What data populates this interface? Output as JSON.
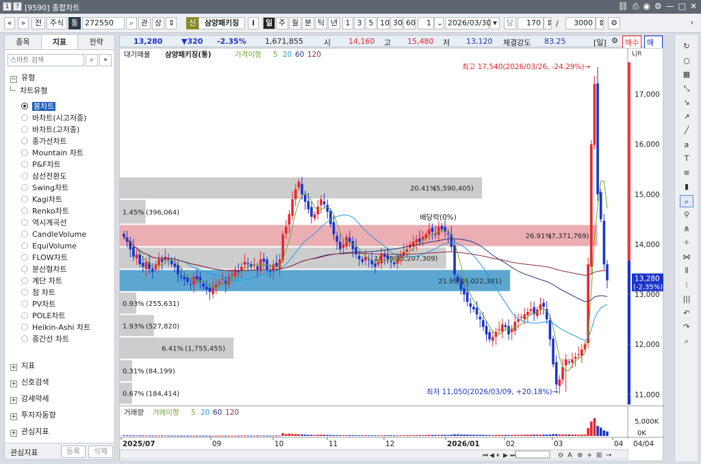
{
  "window": {
    "title": "[9590] 종합차트"
  },
  "toolbar": {
    "market_label": "전",
    "stock_label": "주식",
    "type_badge": "통",
    "code": "272550",
    "gwan": "관",
    "sang": "상",
    "sin_badge": "신",
    "name": "삼양패키징",
    "info_label": "i",
    "periods": [
      "일",
      "주",
      "월",
      "분",
      "틱",
      "년"
    ],
    "minutes": [
      "1",
      "3",
      "5",
      "10",
      "30",
      "60"
    ],
    "interval": "1",
    "date": "2026/03/30",
    "dang": "당",
    "count": "170",
    "slash": "/",
    "total": "3000"
  },
  "left": {
    "tabs": [
      "종목",
      "지표",
      "전략"
    ],
    "search_placeholder": "스마트 검색",
    "group_title": "유형",
    "subgroup": "차트유형",
    "chart_types": [
      "봉차트",
      "바차트(시고저종)",
      "바차트(고저종)",
      "종가선차트",
      "Mountain 차트",
      "P&F차트",
      "삼선전환도",
      "Swing차트",
      "Kagi차트",
      "Renko차트",
      "역시계곡선",
      "CandleVolume",
      "EquiVolume",
      "FLOW차트",
      "분산형차트",
      "계단 차트",
      "점 차트",
      "PV차트",
      "POLE차트",
      "Heikin-Ashi 차트",
      "중간선 차트"
    ],
    "sections": [
      "지표",
      "신호검색",
      "강세약세",
      "투자자동향",
      "관심지표"
    ],
    "bottom_label": "관심지표",
    "register": "등록",
    "delete": "삭제"
  },
  "quote": {
    "price": "13,280",
    "change": "▼320",
    "pct": "-2.35%",
    "volume": "1,671,855",
    "open_label": "시",
    "open": "14,160",
    "high_label": "고",
    "high": "15,480",
    "low_label": "저",
    "low": "13,120",
    "strength_label": "체결강도",
    "strength": "83.25",
    "period_tag": "[일]",
    "buy": "매수",
    "sell": "매도"
  },
  "legend": {
    "title": "대기매물",
    "stock": "삼양패키징(통)",
    "ma_label": "가격이평",
    "ma": [
      "5",
      "20",
      "60",
      "120"
    ]
  },
  "vol_legend": {
    "title": "거래량",
    "ma_label": "거래이평",
    "ma": [
      "5",
      "20",
      "60",
      "120"
    ]
  },
  "annotations": {
    "high": "최고 17,540(2026/03/26, -24.29%)→",
    "low": "최저 11,050(2026/03/09, +20.18%)→",
    "dividend": "배당락(0%)",
    "current_price": "13,280",
    "current_pct": "(-2.35%)"
  },
  "x_labels": [
    "2025/07",
    "09",
    "10",
    "11",
    "12",
    "2026/01",
    "02",
    "03",
    "04"
  ],
  "x_right": "04/04",
  "y_labels": [
    "17,000",
    "16,000",
    "15,000",
    "14,000",
    "13,000",
    "12,000",
    "11,000"
  ],
  "vol_labels": [
    "5,000K",
    "0K"
  ],
  "colors": {
    "up": "#e8262c",
    "down": "#1b35c8",
    "ma5": "#6aa82b",
    "ma20": "#1e9be0",
    "ma60": "#26307c",
    "ma120": "#8a2b3a",
    "band_pink": "#e8a0a6",
    "band_blue": "#3f98c9",
    "band_gray": "#c8c8c8"
  },
  "chart_data": {
    "type": "candlestick",
    "title": "삼양패키징(통)",
    "ylim": [
      10800,
      17800
    ],
    "volume_profile": [
      {
        "price_low": 14900,
        "price_high": 15350,
        "pct": "20.41%",
        "vol": "(5,590,405)"
      },
      {
        "price_low": 14400,
        "price_high": 14900,
        "pct": "1.45%",
        "vol": "(396,064)"
      },
      {
        "price_low": 13950,
        "price_high": 14400,
        "pct": "26.91%",
        "vol": "(7,371,769)",
        "highlight": "pink"
      },
      {
        "price_low": 13500,
        "price_high": 13950,
        "pct": "18.39%",
        "vol": "(5,207,309)"
      },
      {
        "price_low": 13050,
        "price_high": 13500,
        "pct": "21.99%",
        "vol": "(6,022,381)",
        "highlight": "blue"
      },
      {
        "price_low": 12600,
        "price_high": 13050,
        "pct": "0.93%",
        "vol": "(255,631)"
      },
      {
        "price_low": 12150,
        "price_high": 12600,
        "pct": "1.93%",
        "vol": "(527,820)"
      },
      {
        "price_low": 11700,
        "price_high": 12150,
        "pct": "6.41%",
        "vol": "(1,755,455)"
      },
      {
        "price_low": 11250,
        "price_high": 11700,
        "pct": "0.31%",
        "vol": "(84,199)"
      },
      {
        "price_low": 10800,
        "price_high": 11250,
        "pct": "0.67%",
        "vol": "(184,414)"
      }
    ],
    "closes": [
      14150,
      14050,
      13900,
      13750,
      13800,
      13600,
      13550,
      13650,
      13500,
      13450,
      13600,
      13700,
      13650,
      13750,
      13700,
      13600,
      13550,
      13400,
      13350,
      13300,
      13250,
      13200,
      13350,
      13300,
      13250,
      13150,
      13100,
      13050,
      13150,
      13200,
      13250,
      13300,
      13200,
      13350,
      13400,
      13500,
      13450,
      13550,
      13650,
      13600,
      13550,
      13600,
      13500,
      13700,
      13650,
      13500,
      13450,
      13600,
      13550,
      13700,
      14200,
      14350,
      14600,
      14900,
      15100,
      15250,
      15000,
      14850,
      14700,
      14550,
      14600,
      14750,
      14900,
      14800,
      14650,
      14400,
      14200,
      14050,
      13900,
      14000,
      14150,
      14050,
      13900,
      13800,
      13700,
      13650,
      13750,
      13700,
      13600,
      13550,
      13650,
      13800,
      13750,
      13700,
      13650,
      13600,
      13700,
      13800,
      13850,
      13900,
      14000,
      14050,
      14100,
      14050,
      14150,
      14200,
      14300,
      14250,
      14200,
      14350,
      14300,
      14250,
      14200,
      13950,
      13400,
      13250,
      13100,
      13000,
      12850,
      12750,
      12700,
      12600,
      12500,
      12350,
      12200,
      12100,
      12150,
      12250,
      12300,
      12400,
      12350,
      12200,
      12300,
      12450,
      12500,
      12550,
      12600,
      12650,
      12700,
      12600,
      12700,
      12800,
      12750,
      12500,
      12100,
      11600,
      11200,
      11300,
      11550,
      11700,
      11650,
      11700,
      11750,
      11800,
      11900,
      12000,
      13600,
      16000,
      17200,
      15000,
      14500,
      13600,
      13280
    ],
    "volumes": [
      120,
      110,
      100,
      95,
      105,
      90,
      85,
      95,
      80,
      70,
      80,
      90,
      85,
      75,
      70,
      65,
      60,
      55,
      60,
      65,
      55,
      50,
      60,
      58,
      52,
      50,
      48,
      46,
      50,
      52,
      55,
      58,
      50,
      60,
      62,
      70,
      65,
      75,
      80,
      78,
      70,
      72,
      68,
      90,
      85,
      70,
      65,
      75,
      70,
      80,
      520,
      330,
      420,
      380,
      350,
      300,
      260,
      230,
      210,
      200,
      190,
      220,
      240,
      210,
      190,
      170,
      160,
      150,
      140,
      150,
      160,
      150,
      140,
      130,
      120,
      115,
      125,
      120,
      110,
      105,
      110,
      130,
      120,
      115,
      110,
      105,
      115,
      125,
      130,
      135,
      140,
      150,
      160,
      150,
      170,
      180,
      200,
      190,
      180,
      210,
      200,
      190,
      180,
      220,
      300,
      280,
      260,
      250,
      240,
      230,
      220,
      210,
      200,
      190,
      180,
      170,
      175,
      185,
      190,
      200,
      195,
      180,
      190,
      200,
      210,
      220,
      230,
      240,
      250,
      240,
      250,
      260,
      250,
      240,
      260,
      320,
      340,
      300,
      280,
      290,
      270,
      260,
      250,
      240,
      250,
      260,
      1400,
      2600,
      3200,
      1800,
      1500,
      1000,
      800
    ]
  }
}
